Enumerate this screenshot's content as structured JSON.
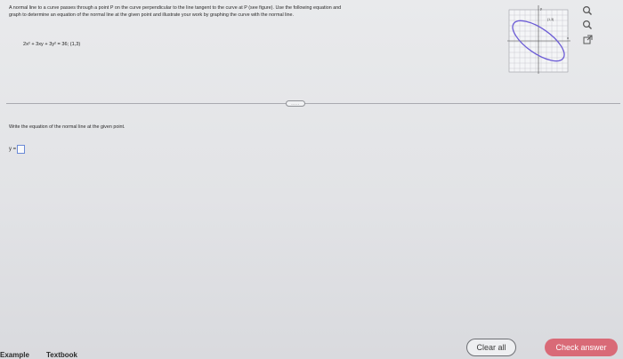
{
  "problem": {
    "line1": "A normal line to a curve passes through a point P on the curve perpendicular to the line tangent to the curve at P (see figure). Use the following equation and",
    "line2": "graph to determine an equation of the normal line at the given point and illustrate your work by graphing the curve with the normal line.",
    "equation": "2x² + 3xy + 3y² = 36; (1,3)"
  },
  "graph": {
    "y_axis_label": "y",
    "x_axis_label": "x",
    "curve_color": "#6b5bd6",
    "point_label": "(1,3)"
  },
  "tools": {
    "zoom_in_icon": "zoom-in-icon",
    "zoom_out_icon": "zoom-out-icon",
    "popout_icon": "external-link-icon"
  },
  "divider": {
    "handle_label": "....."
  },
  "question": {
    "prompt": "Write the equation of the normal line at the given point.",
    "answer_prefix": "y ="
  },
  "footer": {
    "example_label": "Example",
    "textbook_label": "Textbook",
    "clear_label": "Clear all",
    "check_label": "Check answer"
  },
  "colors": {
    "accent": "#d96a77",
    "input_border": "#6b8ad6"
  }
}
